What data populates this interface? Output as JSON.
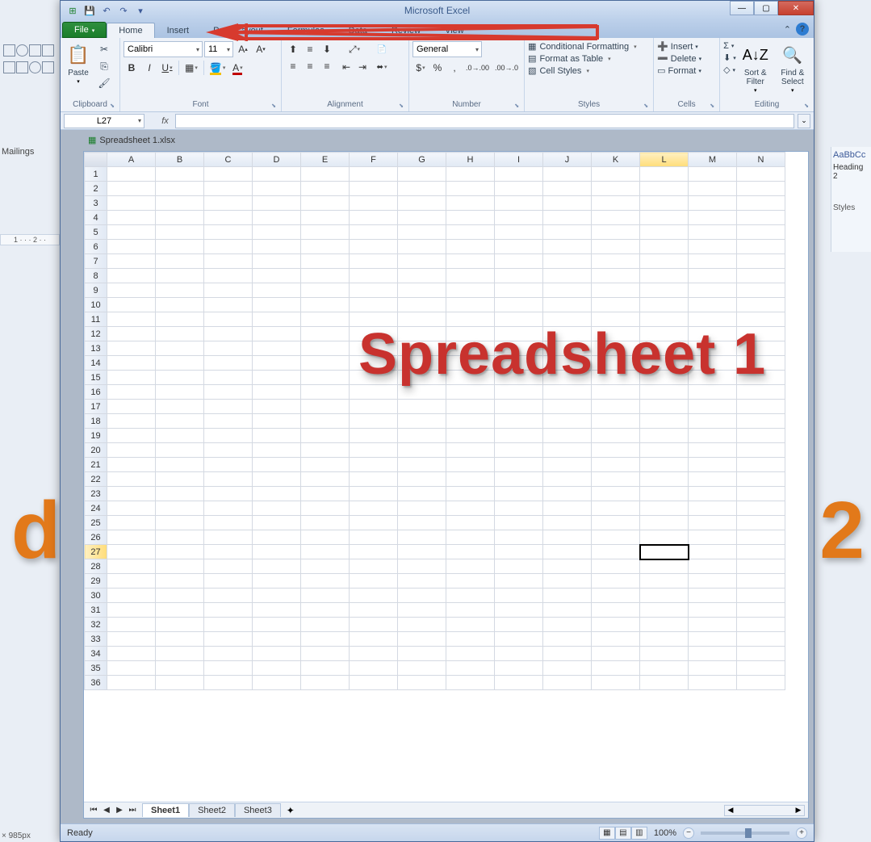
{
  "app_title": "Microsoft Excel",
  "qat": {
    "save": "💾",
    "undo": "↶",
    "redo": "↷"
  },
  "tabs": {
    "file": "File",
    "home": "Home",
    "insert": "Insert",
    "page_layout": "Page Layout",
    "formulas": "Formulas",
    "data": "Data",
    "review": "Review",
    "view": "View"
  },
  "ribbon": {
    "clipboard": {
      "label": "Clipboard",
      "paste": "Paste"
    },
    "font": {
      "label": "Font",
      "name": "Calibri",
      "size": "11"
    },
    "alignment": {
      "label": "Alignment",
      "wrap": "Wrap Text",
      "merge": "Merge & Center"
    },
    "number": {
      "label": "Number",
      "format": "General"
    },
    "styles": {
      "label": "Styles",
      "conditional": "Conditional Formatting",
      "table": "Format as Table",
      "cell": "Cell Styles"
    },
    "cells": {
      "label": "Cells",
      "insert": "Insert",
      "delete": "Delete",
      "format": "Format"
    },
    "editing": {
      "label": "Editing",
      "autosum": "Σ",
      "fill": "⬇",
      "clear": "◇",
      "sort": "Sort & Filter",
      "find": "Find & Select"
    }
  },
  "name_box": "L27",
  "fx_label": "fx",
  "formula_value": "",
  "workbook": {
    "caption": "Spreadsheet 1.xlsx",
    "columns": [
      "A",
      "B",
      "C",
      "D",
      "E",
      "F",
      "G",
      "H",
      "I",
      "J",
      "K",
      "L",
      "M",
      "N"
    ],
    "rows": [
      1,
      2,
      3,
      4,
      5,
      6,
      7,
      8,
      9,
      10,
      11,
      12,
      13,
      14,
      15,
      16,
      17,
      18,
      19,
      20,
      21,
      22,
      23,
      24,
      25,
      26,
      27,
      28,
      29,
      30,
      31,
      32,
      33,
      34,
      35,
      36
    ],
    "active_col": "L",
    "active_row": 27,
    "sheets": [
      "Sheet1",
      "Sheet2",
      "Sheet3"
    ],
    "active_sheet": 0
  },
  "overlay_label": "Spreadsheet 1",
  "status": {
    "left": "Ready",
    "zoom": "100%"
  },
  "bg": {
    "mailings": "Mailings",
    "heading2": "Heading 2",
    "aabb": "AaBbCc",
    "styles_label": "Styles",
    "ruler": "1 · · · 2 · ·",
    "bottom": "× 985px",
    "d": "d",
    "two": "2"
  }
}
